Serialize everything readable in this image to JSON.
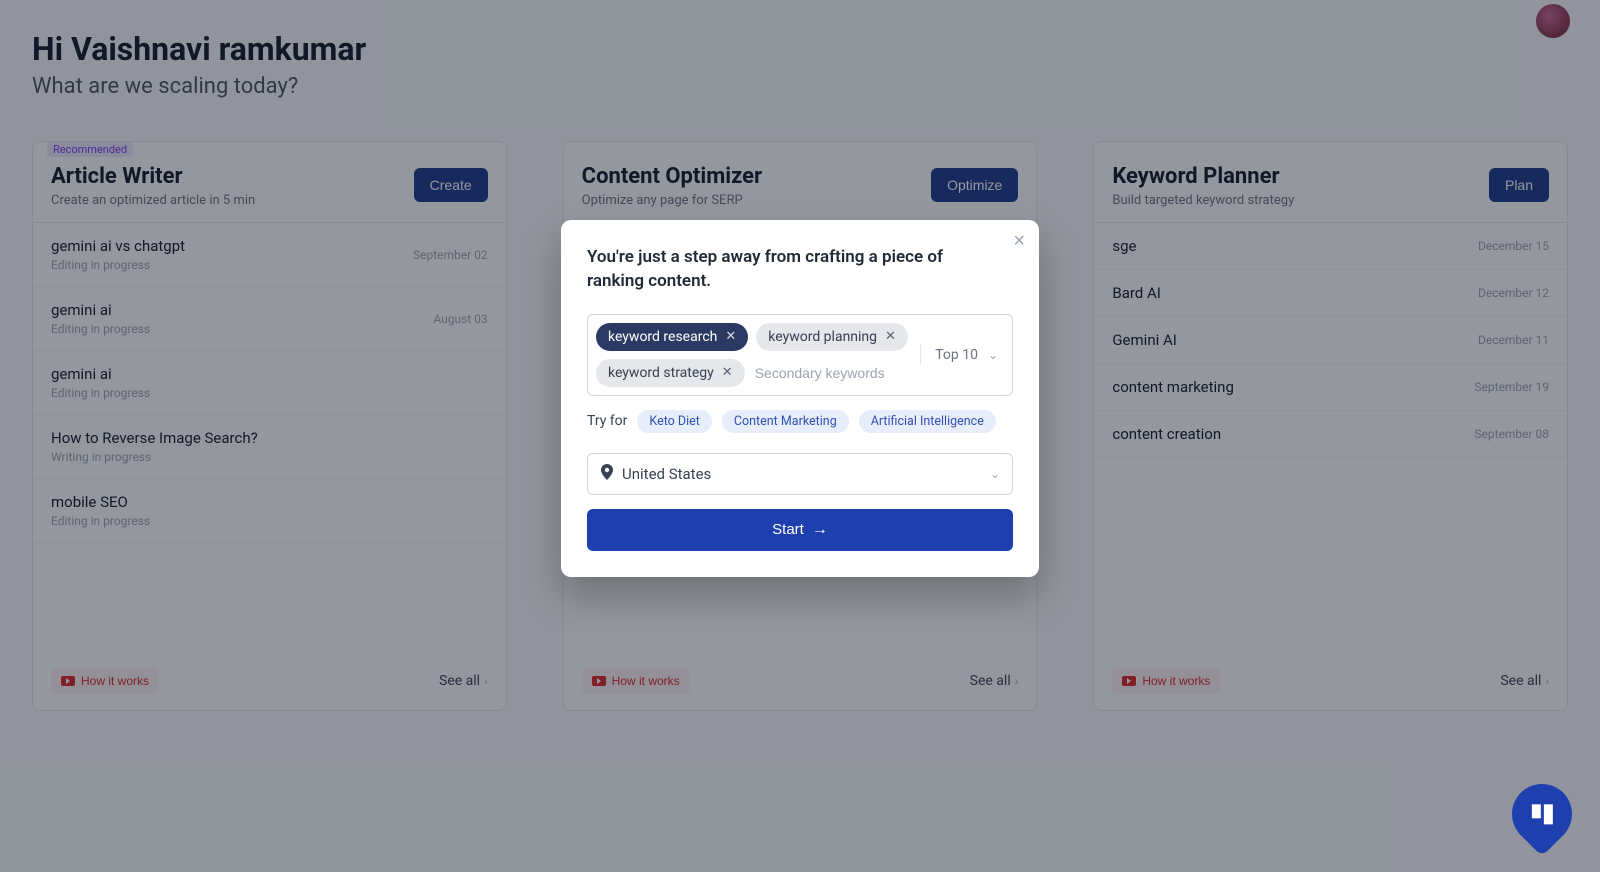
{
  "greeting": "Hi Vaishnavi ramkumar",
  "subheading": "What are we scaling today?",
  "recommended_label": "Recommended",
  "how_it_works": "How it works",
  "see_all": "See all",
  "cards": [
    {
      "title": "Article Writer",
      "subtitle": "Create an optimized article in 5 min",
      "button": "Create",
      "recommended": true,
      "items": [
        {
          "title": "gemini ai vs chatgpt",
          "status": "Editing in progress",
          "date": "September 02"
        },
        {
          "title": "gemini ai",
          "status": "Editing in progress",
          "date": "August 03"
        },
        {
          "title": "gemini ai",
          "status": "Editing in progress",
          "date": ""
        },
        {
          "title": "How to Reverse Image Search?",
          "status": "Writing in progress",
          "date": ""
        },
        {
          "title": "mobile SEO",
          "status": "Editing in progress",
          "date": ""
        }
      ]
    },
    {
      "title": "Content Optimizer",
      "subtitle": "Optimize any page for SERP",
      "button": "Optimize",
      "recommended": false,
      "items": []
    },
    {
      "title": "Keyword Planner",
      "subtitle": "Build targeted keyword strategy",
      "button": "Plan",
      "recommended": false,
      "items": [
        {
          "title": "sge",
          "status": "",
          "date": "December 15"
        },
        {
          "title": "Bard AI",
          "status": "",
          "date": "December 12"
        },
        {
          "title": "Gemini AI",
          "status": "",
          "date": "December 11"
        },
        {
          "title": "content marketing",
          "status": "",
          "date": "September 19"
        },
        {
          "title": "content creation",
          "status": "",
          "date": "September 08"
        }
      ]
    }
  ],
  "modal": {
    "title": "You're just a step away from crafting a piece of ranking content.",
    "primary_keyword": "keyword research",
    "secondary_keywords": [
      "keyword planning",
      "keyword strategy"
    ],
    "placeholder": "Secondary keywords",
    "top_label": "Top 10",
    "try_for_label": "Try for",
    "suggestions": [
      "Keto Diet",
      "Content Marketing",
      "Artificial Intelligence"
    ],
    "location": "United States",
    "start_label": "Start"
  }
}
